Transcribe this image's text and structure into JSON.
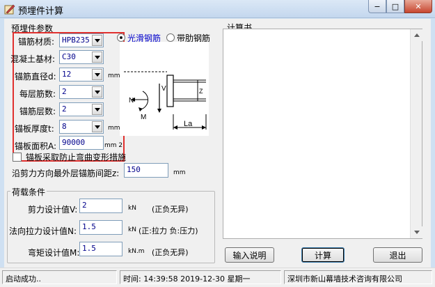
{
  "window": {
    "title": "预埋件计算",
    "minimize_glyph": "−",
    "maximize_glyph": "□",
    "close_glyph": "✕"
  },
  "params": {
    "legend": "预埋件参数",
    "fields": [
      {
        "label": "锚筋材质:",
        "value": "HPB235",
        "kind": "combo"
      },
      {
        "label": "混凝土基材:",
        "value": "C30",
        "kind": "combo"
      },
      {
        "label": "锚筋直径d:",
        "value": "12",
        "kind": "combo",
        "unit": "mm"
      },
      {
        "label": "每层筋数:",
        "value": "2",
        "kind": "combo"
      },
      {
        "label": "锚筋层数:",
        "value": "2",
        "kind": "combo"
      },
      {
        "label": "锚板厚度t:",
        "value": "8",
        "kind": "combo",
        "unit": "mm"
      },
      {
        "label": "锚板面积A:",
        "value": "90000",
        "kind": "edit",
        "unit": "mm 2"
      }
    ],
    "bar_type_options": [
      "光滑钢筋",
      "带肋钢筋"
    ],
    "bar_type_selected": "光滑钢筋",
    "diagram_labels": {
      "v": "V",
      "n": "N",
      "m": "M",
      "z": "Z",
      "la": "La"
    },
    "anti_bending_label": "锚板采取防止弯曲变形措施",
    "anti_bending_checked": false,
    "max_spacing_label": "沿剪力方向最外层锚筋间距z:",
    "max_spacing_value": "150",
    "max_spacing_unit": "mm"
  },
  "loads": {
    "legend": "荷载条件",
    "fields": [
      {
        "label": "剪力设计值V:",
        "value": "2",
        "unit": "kN",
        "note": "(正负无异)"
      },
      {
        "label": "法向拉力设计值N:",
        "value": "1.5",
        "unit": "kN",
        "note": "(正:拉力 负:压力)"
      },
      {
        "label": "弯矩设计值M:",
        "value": "1.5",
        "unit": "kN.m",
        "note": "(正负无异)"
      }
    ]
  },
  "book": {
    "legend": "计算书",
    "content": ""
  },
  "buttons": {
    "input_help": "输入说明",
    "calculate": "计算",
    "exit": "退出"
  },
  "status": {
    "message": "启动成功..",
    "time": "时间: 14:39:58 2019-12-30 星期一",
    "company": "深圳市新山幕墙技术咨询有限公司"
  },
  "colors": {
    "field_text": "#00008b",
    "highlight": "#e0302e",
    "radio_text": "#0000cc"
  }
}
